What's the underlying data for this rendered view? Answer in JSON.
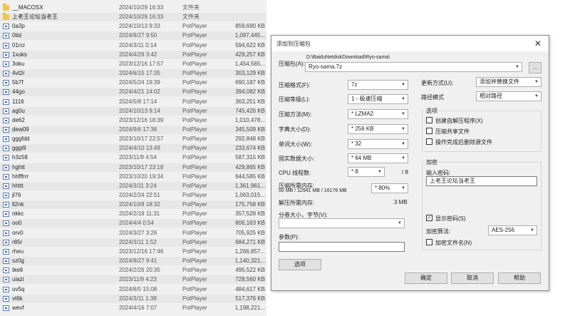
{
  "files": [
    {
      "name": "__MACOSX",
      "date": "2024/10/29 16:33",
      "type": "文件夹",
      "size": "",
      "icon": "folder-icon"
    },
    {
      "name": "上老王论坛当老王",
      "date": "2024/10/29 16:33",
      "type": "文件夹",
      "size": "",
      "icon": "folder-icon"
    },
    {
      "name": "0a3p",
      "date": "2024/10/13 9:33",
      "type": "PotPlayer",
      "size": "859,690 KB",
      "icon": "media-file-icon"
    },
    {
      "name": "0tid",
      "date": "2024/9/27 9:50",
      "type": "PotPlayer",
      "size": "1,097,445...",
      "icon": "media-file-icon"
    },
    {
      "name": "01rcr",
      "date": "2024/3/11 0:14",
      "type": "PotPlayer",
      "size": "594,622 KB",
      "icon": "media-file-icon"
    },
    {
      "name": "1xuks",
      "date": "2024/4/29 3:42",
      "type": "PotPlayer",
      "size": "429,257 KB",
      "icon": "media-file-icon"
    },
    {
      "name": "3oku",
      "date": "2023/12/16 17:57",
      "type": "PotPlayer",
      "size": "1,454,565...",
      "icon": "media-file-icon"
    },
    {
      "name": "4vt2r",
      "date": "2024/6/15 17:35",
      "type": "PotPlayer",
      "size": "303,129 KB",
      "icon": "media-file-icon"
    },
    {
      "name": "5b7f",
      "date": "2024/5/24 19:39",
      "type": "PotPlayer",
      "size": "690,187 KB",
      "icon": "media-file-icon"
    },
    {
      "name": "44go",
      "date": "2024/4/21 14:02",
      "type": "PotPlayer",
      "size": "394,082 KB",
      "icon": "media-file-icon"
    },
    {
      "name": "1116",
      "date": "2024/5/8 17:14",
      "type": "PotPlayer",
      "size": "363,251 KB",
      "icon": "media-file-icon"
    },
    {
      "name": "ag0u",
      "date": "2024/10/13 9:14",
      "type": "PotPlayer",
      "size": "745,426 KB",
      "icon": "media-file-icon"
    },
    {
      "name": "de62",
      "date": "2023/12/16 18:39",
      "type": "PotPlayer",
      "size": "1,010,478...",
      "icon": "media-file-icon"
    },
    {
      "name": "dew09",
      "date": "2024/9/6 17:36",
      "type": "PotPlayer",
      "size": "345,509 KB",
      "icon": "media-file-icon"
    },
    {
      "name": "gggfdd",
      "date": "2023/10/17 22:57",
      "type": "PotPlayer",
      "size": "292,848 KB",
      "icon": "media-file-icon"
    },
    {
      "name": "gggi9",
      "date": "2024/4/10 13:49",
      "type": "PotPlayer",
      "size": "233,674 KB",
      "icon": "media-file-icon"
    },
    {
      "name": "h3z58",
      "date": "2023/11/9 4:54",
      "type": "PotPlayer",
      "size": "587,315 KB",
      "icon": "media-file-icon"
    },
    {
      "name": "hghtt",
      "date": "2023/10/17 23:18",
      "type": "PotPlayer",
      "size": "429,865 KB",
      "icon": "media-file-icon"
    },
    {
      "name": "hhfffrrr",
      "date": "2023/10/20 19:34",
      "type": "PotPlayer",
      "size": "644,585 KB",
      "icon": "media-file-icon"
    },
    {
      "name": "hhttt",
      "date": "2024/3/11 3:24",
      "type": "PotPlayer",
      "size": "1,361,961...",
      "icon": "media-file-icon"
    },
    {
      "name": "jl76",
      "date": "2024/2/24 22:51",
      "type": "PotPlayer",
      "size": "1,063,015...",
      "icon": "media-file-icon"
    },
    {
      "name": "ll2nk",
      "date": "2024/10/8 18:32",
      "type": "PotPlayer",
      "size": "175,758 KB",
      "icon": "media-file-icon"
    },
    {
      "name": "nkkc",
      "date": "2024/2/19 11:31",
      "type": "PotPlayer",
      "size": "357,528 KB",
      "icon": "media-file-icon"
    },
    {
      "name": "oo0",
      "date": "2024/4/4 0:54",
      "type": "PotPlayer",
      "size": "806,163 KB",
      "icon": "media-file-icon"
    },
    {
      "name": "orv0",
      "date": "2024/3/27 3:26",
      "type": "PotPlayer",
      "size": "705,925 KB",
      "icon": "media-file-icon"
    },
    {
      "name": "r85r",
      "date": "2024/3/11 1:52",
      "type": "PotPlayer",
      "size": "684,271 KB",
      "icon": "media-file-icon"
    },
    {
      "name": "rheu",
      "date": "2023/12/16 17:46",
      "type": "PotPlayer",
      "size": "1,266,857...",
      "icon": "media-file-icon"
    },
    {
      "name": "sz0g",
      "date": "2024/9/27 9:41",
      "type": "PotPlayer",
      "size": "1,140,321...",
      "icon": "media-file-icon"
    },
    {
      "name": "tke8",
      "date": "2024/2/26 20:35",
      "type": "PotPlayer",
      "size": "495,522 KB",
      "icon": "media-file-icon"
    },
    {
      "name": "uiazi",
      "date": "2023/11/9 4:23",
      "type": "PotPlayer",
      "size": "728,560 KB",
      "icon": "media-file-icon"
    },
    {
      "name": "uv5q",
      "date": "2024/8/5 15:08",
      "type": "PotPlayer",
      "size": "484,617 KB",
      "icon": "media-file-icon"
    },
    {
      "name": "vt6k",
      "date": "2024/3/11 1:38",
      "type": "PotPlayer",
      "size": "517,376 KB",
      "icon": "media-file-icon"
    },
    {
      "name": "wevf",
      "date": "2024/4/16 7:07",
      "type": "PotPlayer",
      "size": "1,198,221...",
      "icon": "media-file-icon"
    }
  ],
  "dialog": {
    "title": "添加到压缩包",
    "close_glyph": "✕",
    "archive": {
      "label": "压缩包(A):",
      "path": "D:\\BaiduNetdiskDownload\\Ryo-sama\\",
      "value": "Ryo-sama.7z",
      "browse_label": "..."
    },
    "left_fields": [
      {
        "label": "压缩格式(F):",
        "value": "7z"
      },
      {
        "label": "压缩等级(L):",
        "value": "1 - 极速压缩"
      },
      {
        "label": "压缩方法(M):",
        "value": "* LZMA2"
      },
      {
        "label": "字典大小(D):",
        "value": "* 256 KB"
      },
      {
        "label": "单词大小(W):",
        "value": "* 32"
      },
      {
        "label": "固实数据大小:",
        "value": "* 64 MB"
      }
    ],
    "cpu": {
      "label": "CPU 线程数:",
      "value": "* 8",
      "total": "/ 8"
    },
    "memory": {
      "label": "压缩所需内存:",
      "detail": "50 MB / 12941 MB / 16176 MB",
      "value": "* 80%"
    },
    "decompress_memory": {
      "label": "解压所需内存:",
      "value": "3 MB"
    },
    "split": {
      "label": "分卷大小，字节(V):",
      "value": ""
    },
    "params": {
      "label": "参数(P):",
      "value": ""
    },
    "options_button": "选项",
    "update_mode": {
      "label": "更新方式(U):",
      "value": "添加并替换文件"
    },
    "path_mode": {
      "label": "路径模式",
      "value": "相对路径"
    },
    "options_group": {
      "title": "选项",
      "items": [
        {
          "label": "创建自解压程序(X)",
          "checked": false
        },
        {
          "label": "压缩共享文件",
          "checked": false
        },
        {
          "label": "操作完成后删除源文件",
          "checked": false
        }
      ]
    },
    "encryption": {
      "title": "加密",
      "password_label": "输入密码:",
      "password_value": "上老王论坛当老王",
      "show_password": {
        "label": "显示密码(S)",
        "checked": true
      },
      "method_label": "加密算法:",
      "method_value": "AES-256",
      "encrypt_names": {
        "label": "加密文件名(N)",
        "checked": false
      }
    },
    "buttons": {
      "ok": "确定",
      "cancel": "取消",
      "help": "帮助"
    },
    "check_glyph": "✓",
    "dropdown_glyph": "▼"
  }
}
